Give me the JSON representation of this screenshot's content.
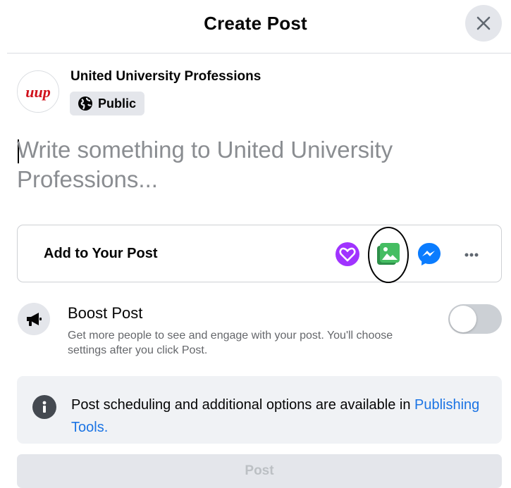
{
  "dialog": {
    "title": "Create Post",
    "close_icon": "close-icon"
  },
  "author": {
    "name": "United University Professions",
    "avatar_text": "uup",
    "audience": "Public",
    "audience_icon": "globe-icon"
  },
  "composer": {
    "placeholder": "Write something to United University Professions..."
  },
  "add_to_post": {
    "label": "Add to Your Post",
    "tools": [
      {
        "name": "fundraiser-icon",
        "color": "#a033ff"
      },
      {
        "name": "photo-video-icon",
        "color": "#45bd62"
      },
      {
        "name": "messenger-icon",
        "color": "#0a7cff"
      },
      {
        "name": "more-options-icon",
        "color": "#606770"
      }
    ]
  },
  "boost": {
    "title": "Boost Post",
    "description": "Get more people to see and engage with your post. You'll choose settings after you click Post.",
    "enabled": false
  },
  "publishing_info": {
    "text": "Post scheduling and additional options are available in ",
    "link": "Publishing Tools."
  },
  "post_button": {
    "label": "Post",
    "enabled": false
  },
  "colors": {
    "link": "#1b74e4",
    "button_disabled_bg": "#e4e6eb",
    "placeholder": "#8a8d91"
  }
}
